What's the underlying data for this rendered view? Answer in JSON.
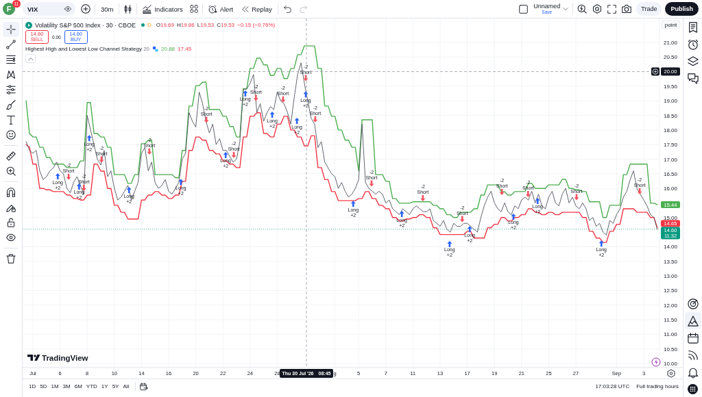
{
  "top_bar": {
    "avatar": {
      "letter": "F",
      "badge": "11"
    },
    "symbol": "VIX",
    "interval": "30m",
    "indicators": "Indicators",
    "alert": "Alert",
    "replay": "Replay",
    "history": [
      {
        "kind": "undo",
        "disabled": false
      },
      {
        "kind": "redo",
        "disabled": true
      }
    ],
    "layout": {
      "name": "Unnamed",
      "save": "Save"
    },
    "trade": "Trade",
    "publish": "Publish"
  },
  "left_toolbar": {
    "groups": [
      [
        {
          "kind": "crosshair",
          "selected": true
        },
        {
          "kind": "trend-line",
          "selected": false
        },
        {
          "kind": "lines",
          "selected": false
        },
        {
          "kind": "pattern",
          "selected": false
        },
        {
          "kind": "forecast",
          "selected": false
        },
        {
          "kind": "brush",
          "selected": false
        },
        {
          "kind": "text",
          "selected": false
        },
        {
          "kind": "emoji",
          "selected": false
        }
      ],
      [
        {
          "kind": "ruler",
          "selected": false
        },
        {
          "kind": "zoom",
          "selected": false
        }
      ],
      [
        {
          "kind": "magnet",
          "selected": false
        },
        {
          "kind": "drawing-lock",
          "selected": false
        },
        {
          "kind": "lock",
          "selected": false
        },
        {
          "kind": "eye",
          "selected": false
        }
      ],
      [
        {
          "kind": "trash",
          "selected": false
        }
      ]
    ]
  },
  "legend": {
    "title": "Volatility S&P 500 Index · 30 · CBOE",
    "market_open": true,
    "data_badge": "D",
    "ohlc": [
      {
        "label": "O",
        "value": "19.69"
      },
      {
        "label": "H",
        "value": "19.86"
      },
      {
        "label": "L",
        "value": "19.53"
      },
      {
        "label": "C",
        "value": "19.53"
      }
    ],
    "change": "−0.15 (−0.76%)",
    "sell": {
      "price": "14.60",
      "label": "SELL"
    },
    "spread": "0.00",
    "buy": {
      "price": "14.60",
      "label": "BUY"
    },
    "indicator": {
      "name": "Highest High and Lowest Low Channel Strategy",
      "param": "20",
      "values": [
        "20.88",
        "17.45"
      ]
    }
  },
  "chart": {
    "unit": "point",
    "logo": "TradingView",
    "chart_data": {
      "type": "line",
      "grid": true,
      "categories": [
        null,
        null,
        "Jul",
        null,
        null,
        null,
        null,
        null,
        null,
        null,
        "6",
        null,
        null,
        null,
        null,
        null,
        null,
        null,
        "8",
        null,
        null,
        null,
        null,
        null,
        null,
        null,
        "10",
        null,
        null,
        null,
        null,
        null,
        null,
        null,
        "14",
        null,
        null,
        null,
        null,
        null,
        null,
        null,
        "16",
        null,
        null,
        null,
        null,
        null,
        null,
        null,
        "20",
        null,
        null,
        null,
        null,
        null,
        null,
        null,
        "22",
        null,
        null,
        null,
        null,
        null,
        null,
        null,
        "24",
        null,
        null,
        null,
        null,
        null,
        null,
        null,
        "28",
        null,
        null,
        null,
        null,
        null,
        null,
        null,
        null,
        null,
        null,
        null,
        null,
        null,
        null,
        null,
        null,
        "g",
        null,
        null,
        null,
        null,
        null,
        null,
        "5",
        null,
        null,
        null,
        null,
        null,
        null,
        null,
        "7",
        null,
        null,
        null,
        null,
        null,
        null,
        null,
        "11",
        null,
        null,
        null,
        null,
        null,
        null,
        null,
        "13",
        null,
        null,
        null,
        null,
        null,
        null,
        null,
        "17",
        null,
        null,
        null,
        null,
        null,
        null,
        null,
        "19",
        null,
        null,
        null,
        null,
        null,
        null,
        null,
        "21",
        null,
        null,
        null,
        null,
        null,
        null,
        null,
        "25",
        null,
        null,
        null,
        null,
        null,
        null,
        null,
        "27",
        null,
        null,
        null,
        null,
        null,
        null,
        null,
        null,
        null,
        null,
        null,
        "Sep",
        null,
        null,
        null,
        null,
        null,
        null,
        null,
        "3",
        null,
        null,
        null,
        null
      ],
      "ylim": [
        9.86,
        21.82
      ],
      "yticks": [
        {
          "value": 21,
          "label": "21.00"
        },
        {
          "value": 20.5,
          "label": "20.50"
        },
        {
          "value": 19.5,
          "label": "19.50"
        },
        {
          "value": 19,
          "label": "19.00"
        },
        {
          "value": 18.5,
          "label": "18.50"
        },
        {
          "value": 18,
          "label": "18.00"
        },
        {
          "value": 17.5,
          "label": "17.50"
        },
        {
          "value": 17,
          "label": "17.00"
        },
        {
          "value": 16.5,
          "label": "16.50"
        },
        {
          "value": 16,
          "label": "16.00"
        },
        {
          "value": 15,
          "label": "15.00"
        },
        {
          "value": 14,
          "label": "14.00"
        },
        {
          "value": 13.5,
          "label": "13.50"
        },
        {
          "value": 13,
          "label": "13.00"
        },
        {
          "value": 12.5,
          "label": "12.50"
        },
        {
          "value": 12,
          "label": "12.00"
        },
        {
          "value": 11.5,
          "label": "11.50"
        },
        {
          "value": 11,
          "label": "11.00"
        },
        {
          "value": 10.5,
          "label": "10.50"
        },
        {
          "value": 10,
          "label": "10.00"
        }
      ],
      "series": [
        {
          "color": "#4caf50",
          "values": [
            19.0,
            17.88,
            17.76,
            17.76,
            17.41,
            17.41,
            17.06,
            17.06,
            16.83,
            16.83,
            16.83,
            16.83,
            16.71,
            16.71,
            16.71,
            16.71,
            16.94,
            16.94,
            18.94,
            18.94,
            17.88,
            17.88,
            17.76,
            17.76,
            17.41,
            17.41,
            16.47,
            16.47,
            16.47,
            16.47,
            16.17,
            16.17,
            16.47,
            16.47,
            17.53,
            17.53,
            17.65,
            17.65,
            16.47,
            16.47,
            16.47,
            16.47,
            16.47,
            16.47,
            16.36,
            16.36,
            17.3,
            17.3,
            18.82,
            18.82,
            19.52,
            19.52,
            19.64,
            19.64,
            18.7,
            18.7,
            18.7,
            18.7,
            18.47,
            18.47,
            18.12,
            18.12,
            17.76,
            17.76,
            19.41,
            19.41,
            20.11,
            20.11,
            20.46,
            20.46,
            20.23,
            20.23,
            19.87,
            19.87,
            20.11,
            20.11,
            19.76,
            19.76,
            20.11,
            20.11,
            20.58,
            20.58,
            20.88,
            20.88,
            20.88,
            20.88,
            20.11,
            20.11,
            18.82,
            18.82,
            18.47,
            18.47,
            18.0,
            18.0,
            17.65,
            17.65,
            17.41,
            17.41,
            16.59,
            18.35,
            18.35,
            18.35,
            18.35,
            16.47,
            16.47,
            16.47,
            16.24,
            16.24,
            15.65,
            15.65,
            15.49,
            15.49,
            15.49,
            15.49,
            15.54,
            15.54,
            15.54,
            15.54,
            15.54,
            15.54,
            15.42,
            15.42,
            15.3,
            15.3,
            15.1,
            15.1,
            15.0,
            15.0,
            15.18,
            15.18,
            15.18,
            15.18,
            15.3,
            15.3,
            15.77,
            15.77,
            16.12,
            16.12,
            16.12,
            16.12,
            15.89,
            15.89,
            15.77,
            15.77,
            15.89,
            15.89,
            15.89,
            15.89,
            16.17,
            16.17,
            16.0,
            16.0,
            16.0,
            16.0,
            16.12,
            16.12,
            16.12,
            16.12,
            16.31,
            16.31,
            16.0,
            16.0,
            15.95,
            15.95,
            15.89,
            15.89,
            15.54,
            15.54,
            15.54,
            15.54,
            15.0,
            15.0,
            15.42,
            15.42,
            15.42,
            15.42,
            16.47,
            16.47,
            16.83,
            16.83,
            16.83,
            16.83,
            16.83,
            16.83,
            15.49,
            15.49,
            15.44
          ]
        },
        {
          "color": "#f23645",
          "values": [
            17.5,
            17.41,
            16.83,
            16.83,
            16.0,
            16.0,
            15.95,
            15.95,
            15.89,
            15.89,
            15.89,
            15.89,
            15.77,
            15.77,
            15.65,
            15.65,
            15.6,
            15.6,
            15.77,
            15.77,
            16.83,
            16.83,
            16.59,
            16.59,
            16.0,
            16.0,
            15.42,
            15.42,
            15.18,
            15.18,
            14.95,
            14.95,
            14.95,
            14.95,
            15.6,
            15.6,
            15.77,
            15.77,
            15.89,
            15.89,
            15.77,
            15.77,
            15.65,
            15.65,
            15.77,
            15.77,
            16.24,
            16.24,
            17.3,
            17.3,
            17.76,
            17.76,
            17.65,
            17.65,
            17.3,
            17.3,
            17.18,
            17.18,
            16.94,
            16.94,
            16.83,
            16.83,
            16.71,
            16.71,
            17.76,
            17.76,
            18.47,
            18.47,
            18.59,
            18.59,
            17.88,
            17.88,
            17.76,
            17.76,
            18.2,
            18.2,
            18.47,
            18.47,
            18.0,
            18.0,
            17.76,
            17.76,
            17.45,
            17.45,
            17.8,
            17.8,
            16.71,
            16.71,
            16.3,
            16.3,
            15.89,
            15.89,
            15.58,
            15.58,
            15.58,
            15.58,
            15.58,
            15.58,
            15.65,
            15.65,
            15.89,
            15.89,
            15.65,
            15.65,
            15.42,
            15.42,
            15.3,
            15.3,
            15.0,
            15.0,
            14.88,
            14.88,
            14.95,
            14.95,
            15.0,
            15.0,
            15.1,
            15.1,
            15.0,
            15.0,
            14.65,
            14.65,
            14.42,
            14.42,
            14.42,
            14.42,
            14.42,
            14.42,
            14.42,
            14.42,
            14.53,
            14.53,
            14.3,
            14.3,
            14.3,
            14.3,
            14.65,
            14.65,
            14.77,
            14.77,
            15.0,
            15.0,
            14.88,
            14.88,
            15.0,
            15.0,
            15.1,
            15.1,
            15.3,
            15.3,
            15.18,
            15.18,
            15.1,
            15.1,
            15.18,
            15.18,
            15.1,
            15.1,
            15.18,
            15.18,
            15.18,
            15.18,
            15.18,
            15.18,
            15.0,
            15.0,
            14.53,
            14.53,
            14.3,
            14.3,
            14.15,
            14.15,
            14.53,
            14.53,
            14.77,
            14.77,
            15.3,
            15.3,
            15.3,
            15.3,
            15.18,
            15.18,
            15.18,
            15.18,
            15.0,
            15.0,
            14.65
          ]
        },
        {
          "color": "#50535e",
          "values": [
            17.6,
            17.3,
            17.2,
            17.3,
            16.6,
            16.3,
            16.4,
            16.6,
            16.7,
            16.9,
            16.6,
            16.5,
            16.0,
            15.85,
            16.2,
            16.4,
            16.1,
            15.8,
            18.5,
            18.0,
            17.5,
            17.0,
            16.8,
            17.3,
            16.4,
            16.6,
            16.0,
            15.6,
            15.7,
            15.9,
            16.1,
            15.6,
            15.9,
            16.2,
            17.2,
            17.4,
            16.6,
            16.9,
            16.2,
            16.0,
            16.1,
            16.3,
            15.9,
            15.8,
            16.0,
            16.2,
            17.0,
            17.2,
            18.6,
            18.3,
            18.1,
            19.3,
            18.9,
            18.3,
            17.9,
            18.2,
            17.5,
            17.7,
            17.3,
            17.3,
            17.1,
            16.9,
            17.0,
            17.6,
            19.4,
            19.4,
            19.6,
            19.9,
            18.6,
            18.9,
            18.3,
            18.6,
            18.8,
            18.7,
            19.3,
            19.0,
            18.9,
            18.6,
            18.2,
            19.1,
            19.9,
            20.3,
            19.6,
            19.0,
            18.4,
            18.2,
            17.4,
            17.6,
            16.9,
            16.7,
            16.5,
            16.4,
            16.0,
            16.2,
            15.9,
            15.7,
            15.8,
            16.0,
            16.3,
            18.2,
            16.2,
            16.0,
            15.9,
            15.8,
            15.9,
            15.8,
            15.5,
            15.6,
            15.3,
            15.2,
            15.1,
            15.3,
            15.2,
            15.1,
            15.3,
            15.4,
            15.3,
            15.2,
            15.2,
            15.3,
            14.9,
            14.8,
            14.7,
            14.9,
            14.6,
            14.5,
            14.8,
            14.7,
            14.7,
            14.8,
            14.8,
            14.7,
            14.6,
            14.5,
            15.0,
            15.4,
            15.7,
            15.9,
            15.5,
            15.3,
            15.2,
            15.5,
            15.2,
            15.1,
            15.4,
            15.3,
            15.6,
            15.7,
            15.6,
            15.9,
            15.5,
            15.8,
            15.4,
            15.3,
            15.7,
            15.9,
            15.5,
            15.4,
            15.8,
            16.0,
            15.5,
            15.7,
            15.4,
            15.3,
            15.5,
            15.3,
            14.9,
            15.0,
            14.7,
            14.8,
            14.5,
            14.4,
            14.9,
            14.8,
            15.1,
            15.3,
            15.7,
            15.9,
            16.3,
            16.6,
            16.0,
            15.8,
            15.6,
            15.4,
            15.1,
            15.0,
            14.6
          ]
        }
      ],
      "annotations": [
        "Long\n+2",
        "-2\nShort",
        "Long\n+2",
        "-2\nShort",
        "Long\n+2",
        "-2\nShort",
        "Long\n+2",
        "-2\nShort",
        "Long\n+2",
        "-2\nShort",
        "Long\n+2",
        "-2\nShort",
        "Long\n+2",
        "-2\nShort",
        "Long\n+2",
        "-2\nShort",
        "Long\n+2",
        "-2\nShort",
        "Long\n+2",
        "-2\nShort",
        "Long\n+2",
        "-2\nShort",
        "Long\n+2",
        "-2\nShort",
        "Long\n+2",
        "-2\nShort",
        "Long\n+2",
        "-2\nShort",
        "Long\n+2",
        "-2\nShort",
        "Long\n+2",
        "-2\nShort",
        "Long\n+2",
        "-2\nShort"
      ]
    },
    "crosshair": {
      "price_label": "20.00",
      "date": "Thu 30 Jul '26",
      "time": "08:45"
    },
    "price_badges": [
      {
        "kind": "upper",
        "text": "15.44",
        "color": "#4caf50"
      },
      {
        "kind": "lower",
        "text": "14.65",
        "color": "#f23645"
      },
      {
        "kind": "last",
        "text": "14.60",
        "countdown": "11:32",
        "color": "#089981"
      }
    ]
  },
  "bottom_bar": {
    "ranges": [
      "1D",
      "5D",
      "1M",
      "3M",
      "6M",
      "YTD",
      "1Y",
      "5Y",
      "All"
    ],
    "clock": "17:03:28 UTC",
    "session": "Full trading hours"
  },
  "right_sidebar": {
    "top": [
      {
        "kind": "watchlist",
        "selected": false
      },
      {
        "kind": "alarm",
        "selected": false
      },
      {
        "kind": "layers",
        "selected": false
      },
      {
        "kind": "chat",
        "selected": false
      }
    ],
    "bottom": [
      {
        "kind": "target",
        "selected": false
      },
      {
        "kind": "pyramid",
        "selected": true
      },
      {
        "kind": "calendar",
        "selected": false
      },
      {
        "kind": "signal",
        "selected": false
      },
      {
        "kind": "bell",
        "selected": false
      }
    ]
  }
}
